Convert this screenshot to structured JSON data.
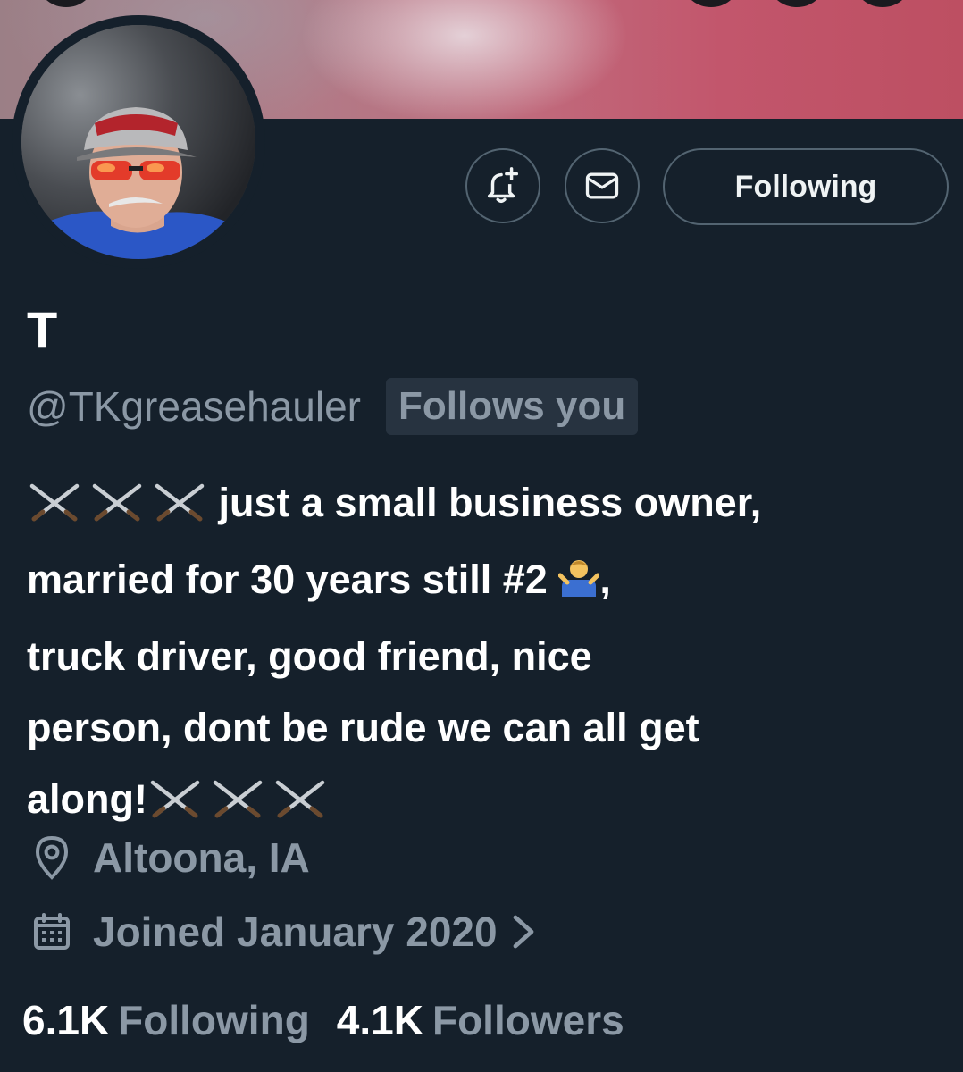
{
  "header": {
    "follow_button_label": "Following"
  },
  "profile": {
    "display_name": "T",
    "handle": "@TKgreasehauler",
    "follows_you_badge": "Follows you",
    "bio_line_1": "just a small business owner,",
    "bio_line_2": "married for 30 years still #2",
    "bio_line_2_end": ",",
    "bio_line_3": "truck driver, good friend, nice",
    "bio_line_4": "person, dont be rude we can all get",
    "bio_line_5": "along!",
    "location": "Altoona, IA",
    "joined": "Joined January 2020"
  },
  "stats": {
    "following_count": "6.1K",
    "following_label": "Following",
    "followers_count": "4.1K",
    "followers_label": "Followers"
  },
  "icons": {
    "notify": "bell-plus-icon",
    "message": "envelope-icon",
    "location": "map-pin-icon",
    "joined": "calendar-icon",
    "chevron": "chevron-right-icon",
    "emoji_swords": "crossed-swords-emoji",
    "emoji_shrug": "man-shrugging-emoji"
  },
  "colors": {
    "background": "#15202b",
    "secondary_text": "#8b98a5",
    "border": "#536471"
  }
}
